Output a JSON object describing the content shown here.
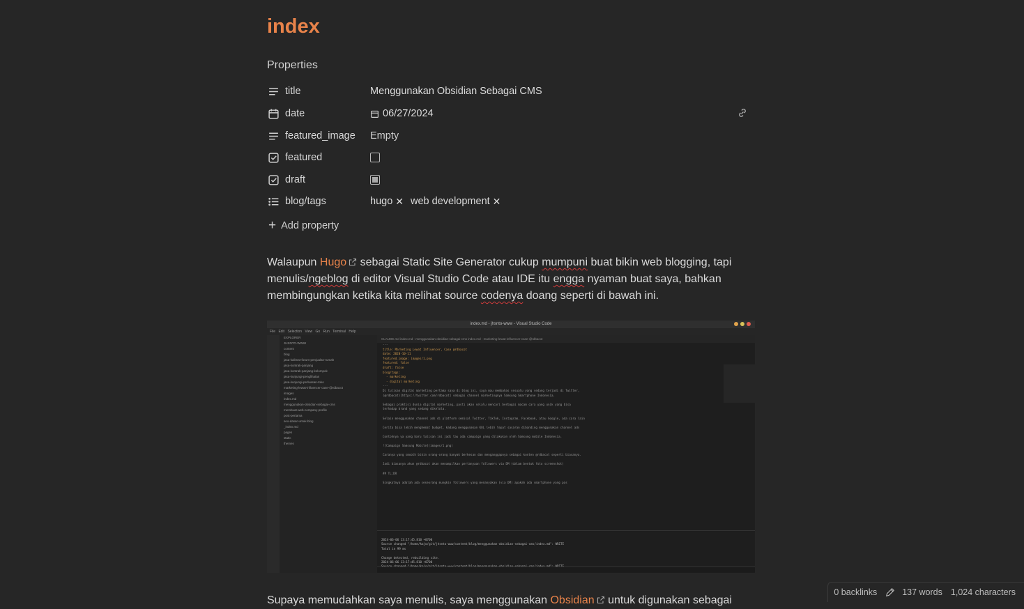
{
  "note": {
    "title": "index",
    "properties_heading": "Properties",
    "properties": {
      "title": {
        "key": "title",
        "value": "Menggunakan Obsidian Sebagai CMS"
      },
      "date": {
        "key": "date",
        "value": "06/27/2024"
      },
      "featured_image": {
        "key": "featured_image",
        "value": "Empty"
      },
      "featured": {
        "key": "featured",
        "checked": false
      },
      "draft": {
        "key": "draft",
        "checked": true
      },
      "tags": {
        "key": "blog/tags",
        "values": [
          "hugo",
          "web development"
        ]
      }
    },
    "add_property": "Add property"
  },
  "body": {
    "p1": {
      "t1": "Walaupun ",
      "link": "Hugo",
      "t2": " sebagai Static Site Generator cukup ",
      "sq1": "mumpuni",
      "t3": " buat bikin web blogging, tapi menulis/",
      "sq2": "ngeblog",
      "t4": " di editor Visual Studio Code atau IDE itu ",
      "sq3": "engga",
      "t5": "  nyaman buat saya, bahkan membingungkan ketika kita melihat source ",
      "sq4": "codenya",
      "t6": " doang seperti di bawah ini."
    },
    "p2": {
      "t1": "Supaya memudahkan saya menulis, saya menggunakan ",
      "link": "Obsidian",
      "t2": " untuk digunakan sebagai"
    }
  },
  "screenshot": {
    "window_title": "index.md - jhsnto-www - Visual Studio Code",
    "menu": "File Edit Selection View Go Run Terminal Help",
    "explorer_title": "EXPLORER",
    "tabs": "CLAUDE.md   index.md - menggunakan-obsidian-sebagai-cms   index.md - marketing-lewat-influencer-case-@rdbacot",
    "sidebar_lines": [
      "JHSNTO-WWW",
      "content",
      "blog",
      "jasa-kalimat-forum-penjualan-rumah",
      "jasa-kontrak-panjang",
      "jasa-kontrak-panjang-kelompok",
      "jasa-kunjungi-penglihatan",
      "jasa-kunjungi-perluasan-toko",
      "marketing-lewat-influencer-case-@rdbacot",
      "images",
      "index.md",
      "menggunakan-obsidian-sebagai-cms",
      "membuat-web-company-profile",
      "post-pertama",
      "seo-dasar-untuk-blog",
      "_index.md",
      "pages",
      "static",
      "themes"
    ],
    "code_lines": [
      "---",
      "title: Marketing Lewat Influencer, Case @rdbacot",
      "date: 2020-10-11",
      "featured_image: images/1.png",
      "featured: false",
      "draft: false",
      "blog/tags:",
      "  - marketing",
      "  - digital marketing",
      "---",
      "Di tulisan digital marketing pertama saya di blog ini, saya mau membahas sesuatu yang sedang terjadi di Twitter,",
      "(@rdbacot)[https://twitter.com/rdbacot] sebagai channel marketingnya Samsung Smartphone Indonesia.",
      "",
      "Sebagai praktisi dunia digital marketing, pasti akan selalu mencari berbagai macam cara yang unik yang bisa",
      "terhadap brand yang sedang dikelola.",
      "",
      "Selain menggunakan channel ads di platform semisal Twitter, TikTok, Instagram, Facebook, atau Google, ada cara lain",
      "",
      "Cerita bisa lebih menghemat budget, kadang menggunakan KOL lebih tepat sasaran dibanding menggunakan channel ads",
      "",
      "Contohnya ya yang baru tulisan ini jadi tau ada campaign yang dilakukan oleh Samsung mobile Indonesia.",
      "",
      "![Campaign Samsung Mobile](images/1.png)",
      "",
      "Caranya yang smooth bikin orang-orang banyak berkesan dan menganggapnya sebagai konten @rdbacot seperti biasanya.",
      "",
      "Jadi biasanya akun @rdbacot akan menampilkan pertanyaan followers via DM (dalam bentuk foto screenshot)",
      "",
      "## TL;DR",
      "",
      "Singkatnya adalah ada seseorang mungkin followers yang menanyakan (via DM) apakah ada smartphone yang pas"
    ],
    "terminal_lines": [
      "2024-06-06 13:17:45.810 +0700",
      "Source changed \"/home/kajo/git/jhsnto-www/content/blog/menggunakan-obsidian-sebagai-cms/index.md\": WRITE",
      "Total in 99 ms",
      "",
      "Change detected, rebuilding site.",
      "2024-06-06 13:17:45.810 +0700",
      "Source changed \"/home/kajo/git/jhsnto-www/content/blog/menggunakan-obsidian-sebagai-cms/index.md\": WRITE",
      "Total in 25 ms"
    ]
  },
  "status_bar": {
    "backlinks": "0 backlinks",
    "words": "137 words",
    "characters": "1,024 characters"
  },
  "colors": {
    "background": "#262626",
    "accent": "#e8834a",
    "text": "#dadada"
  }
}
